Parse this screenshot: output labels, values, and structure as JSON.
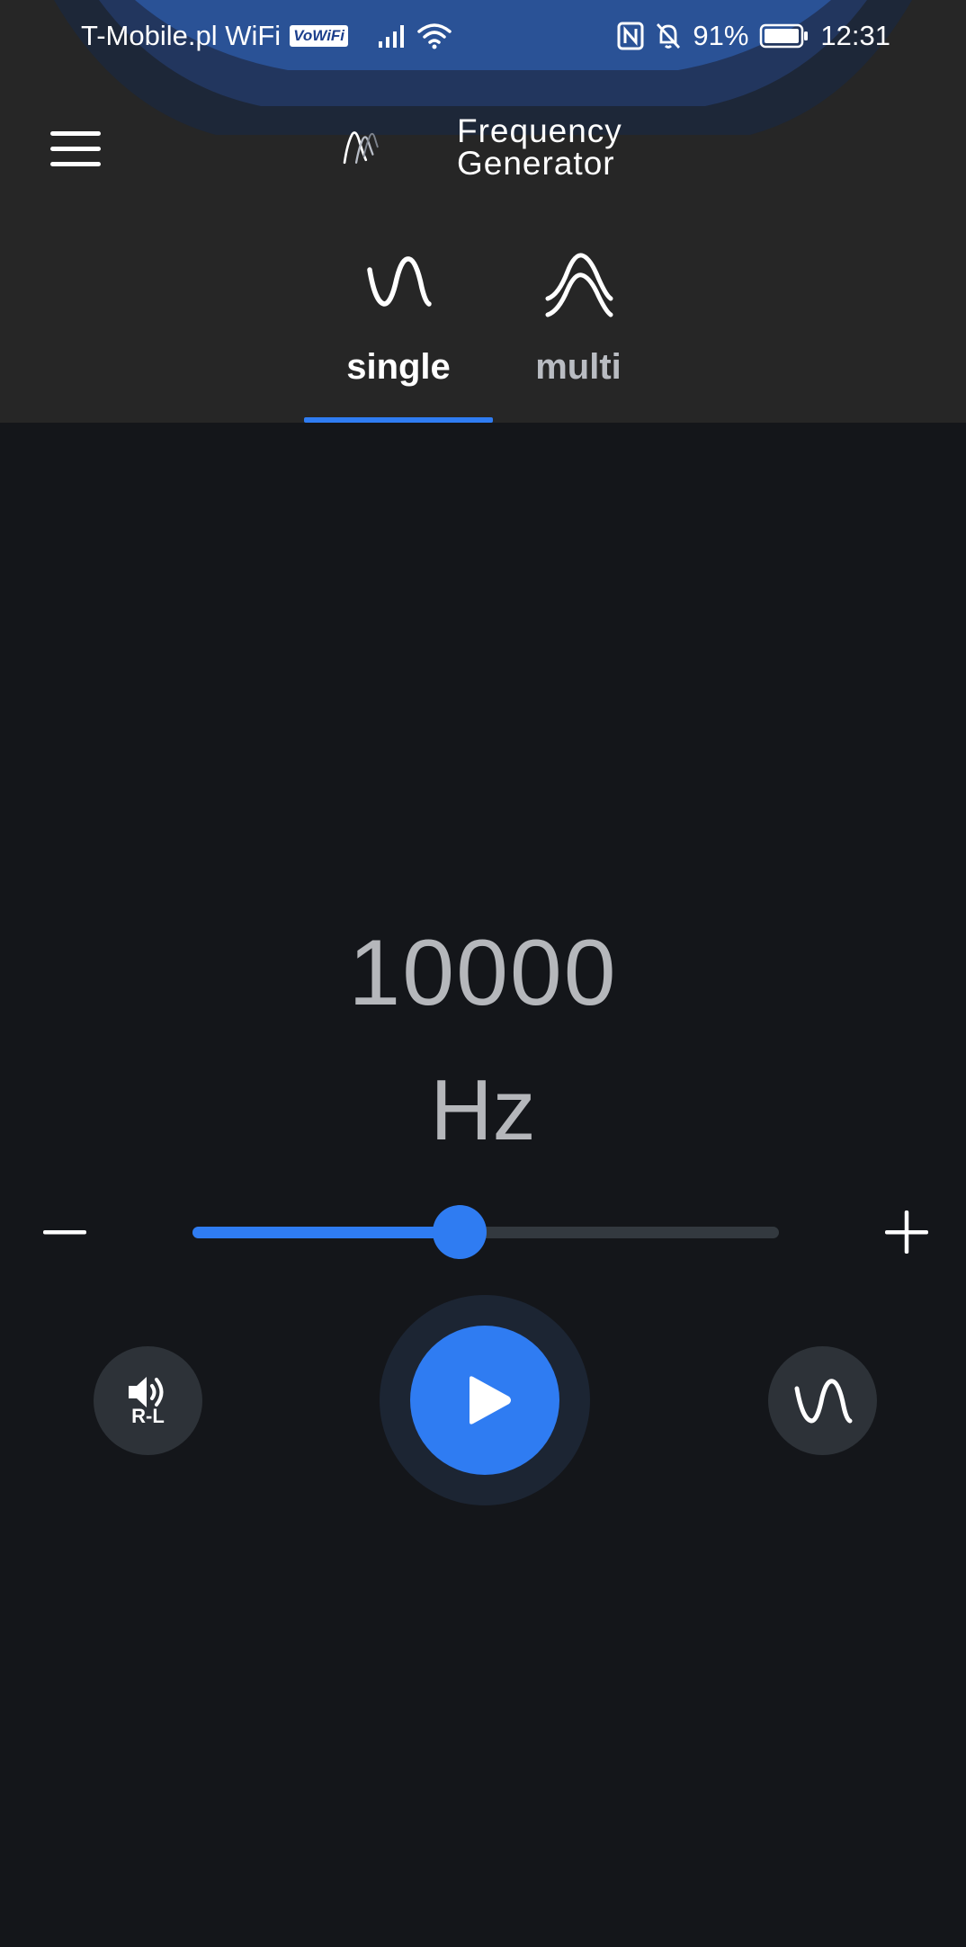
{
  "status_bar": {
    "carrier": "T-Mobile.pl WiFi",
    "vowifi_badge": "VoWiFi",
    "battery_percent": "91%",
    "time": "12:31",
    "icons": [
      "signal-icon",
      "wifi-icon",
      "nfc-icon",
      "bell-off-icon",
      "battery-icon"
    ]
  },
  "header": {
    "menu_icon": "hamburger-menu-icon",
    "title_line1": "Frequency",
    "title_line2": "Generator"
  },
  "tabs": [
    {
      "label": "single",
      "icon": "sine-wave-icon",
      "selected": true
    },
    {
      "label": "multi",
      "icon": "multi-wave-icon",
      "selected": false
    }
  ],
  "generator": {
    "frequency": "10000",
    "unit": "Hz",
    "slider_fraction": 0.455,
    "decrease_icon": "minus-icon",
    "increase_icon": "plus-icon"
  },
  "controls": {
    "channel_label": "R-L",
    "channel_icon": "speaker-icon",
    "play_icon": "play-icon",
    "waveform_icon": "sine-wave-icon"
  },
  "colors": {
    "accent": "#2f7cf2",
    "background": "#14161a",
    "header_background": "#262626",
    "text_muted": "#b5b7bb"
  }
}
